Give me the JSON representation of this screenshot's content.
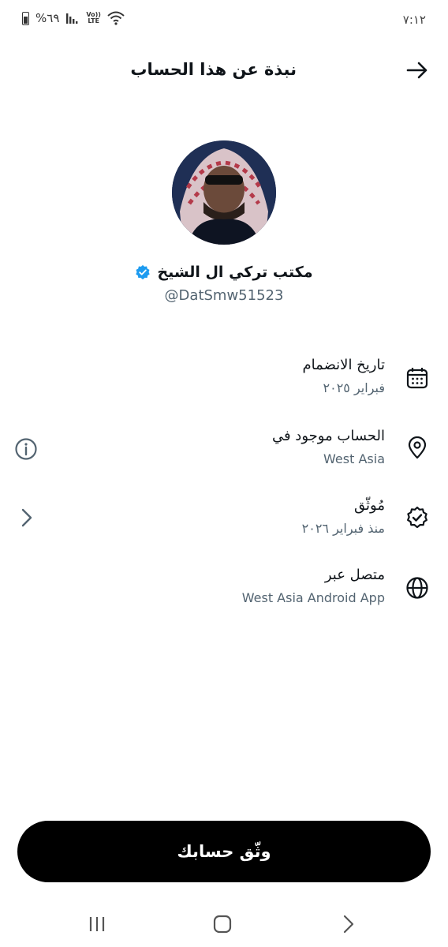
{
  "status_bar": {
    "time": "٧:١٢",
    "battery": "%٦٩",
    "volte": "Vo))\nLTE"
  },
  "header": {
    "title": "نبذة عن هذا الحساب",
    "back_icon": "arrow-right-icon"
  },
  "profile": {
    "display_name": "مكتب تركي ال الشيخ",
    "handle": "@DatSmw51523",
    "verified_color": "#1d9bf0"
  },
  "info_rows": [
    {
      "label": "تاريخ الانضمام",
      "value": "فبراير ٢٠٢٥",
      "icon": "calendar-icon"
    },
    {
      "label": "الحساب موجود في",
      "value": "West Asia",
      "icon": "location-pin-icon",
      "side_icon": "info-icon"
    },
    {
      "label": "مُوثّق",
      "value": "منذ فبراير ٢٠٢٦",
      "icon": "verified-badge-icon",
      "side_icon": "chevron-left-icon"
    },
    {
      "label": "متصل عبر",
      "value": "West Asia Android App",
      "icon": "globe-icon"
    }
  ],
  "cta": {
    "label": "وثّق حسابك"
  },
  "nav": {
    "icons": [
      "recent-apps-icon",
      "home-icon",
      "back-icon"
    ]
  }
}
